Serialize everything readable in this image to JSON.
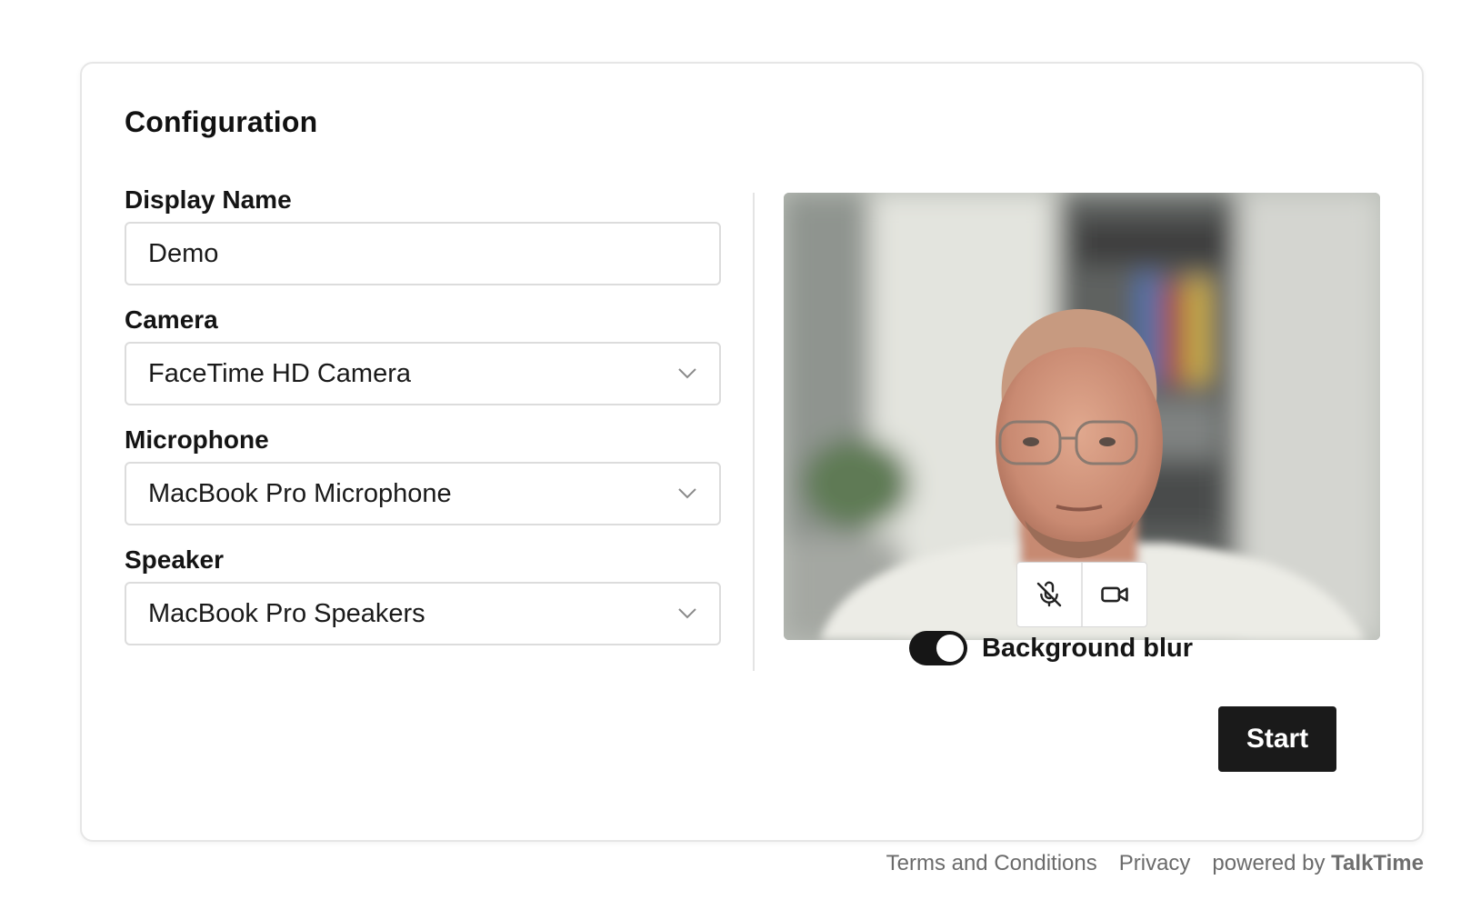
{
  "config": {
    "title": "Configuration",
    "display_name": {
      "label": "Display Name",
      "value": "Demo"
    },
    "camera": {
      "label": "Camera",
      "selected": "FaceTime HD Camera"
    },
    "microphone": {
      "label": "Microphone",
      "selected": "MacBook Pro Microphone"
    },
    "speaker": {
      "label": "Speaker",
      "selected": "MacBook Pro Speakers"
    }
  },
  "preview": {
    "mic_icon": "mic-off-icon",
    "camera_icon": "video-camera-icon",
    "background_blur": {
      "label": "Background blur",
      "enabled": true
    }
  },
  "actions": {
    "start_label": "Start"
  },
  "footer": {
    "terms": "Terms and Conditions",
    "privacy": "Privacy",
    "powered_by": "powered by",
    "brand": "TalkTime"
  },
  "colors": {
    "primary": "#1a1a1a",
    "border": "#dcdcdc",
    "muted_text": "#6b6b6b"
  }
}
